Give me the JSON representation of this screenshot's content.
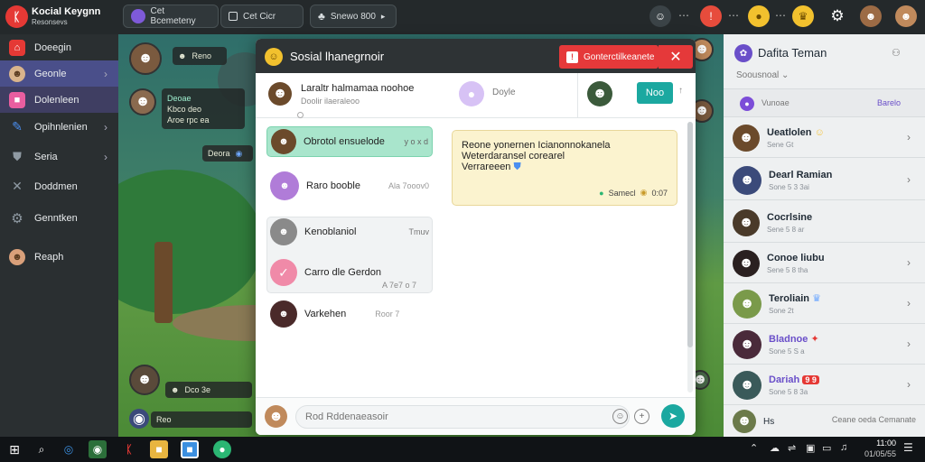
{
  "app": {
    "title": "Kocial Keygnn",
    "subtitle": "Resonsevs",
    "logo": "ᛕ"
  },
  "topbar": {
    "search_label": "Cet Bcemeteny",
    "tab_label": "Cet Cicr",
    "game_label": "Snewo 800",
    "icons": [
      "user-icon",
      "notification-icon",
      "coin-icon",
      "trophy-icon",
      "settings-icon"
    ]
  },
  "sidebar": {
    "items": [
      {
        "label": "Doeegin",
        "icon": "home-icon",
        "color": "#e53935"
      },
      {
        "label": "Geonle",
        "icon": "people-icon",
        "color": "#d9b48c",
        "active": true
      },
      {
        "label": "Dolenleen",
        "icon": "folder-icon",
        "color": "#e95ea0"
      },
      {
        "label": "Opihnlenien",
        "icon": "pen-icon",
        "color": "#4b8ff0"
      },
      {
        "label": "Seria",
        "icon": "shield-icon",
        "color": "#8f9aa3"
      },
      {
        "label": "Doddmen",
        "icon": "tools-icon",
        "color": "#8f9aa3"
      },
      {
        "label": "Genntken",
        "icon": "gear-icon",
        "color": "#8f9aa3"
      },
      {
        "label": "Reaph",
        "icon": "avatar-icon",
        "color": "#d9a07a"
      }
    ]
  },
  "scene": {
    "bubbles": [
      {
        "label": "Reno"
      },
      {
        "label": "Deoae",
        "line2": "Kbco deo",
        "line3": "Aroe rpc ea"
      },
      {
        "label": "Deora"
      },
      {
        "label": "Dco 3e"
      },
      {
        "label": "Reo"
      }
    ]
  },
  "modal": {
    "title": "Sosial lhanegrnoir",
    "warning": "Gonterctilkeanete",
    "close_label": "✕",
    "conversation": {
      "title": "Laraltr halmamaa noohoe",
      "subtitle": "Doolir ilaeraleoo",
      "second_label": "Doyle",
      "button": "Noo"
    },
    "messages": [
      {
        "text": "Obrotol ensuelode",
        "meta": "y o x d",
        "highlight": true
      },
      {
        "text": "Raro booble",
        "meta": "Ala  7ooov0"
      },
      {
        "text": "Kenoblaniol",
        "meta": "Tmuv"
      },
      {
        "text": "Carro dle Gerdon",
        "meta": "A  7e7  o 7"
      },
      {
        "text": "Varkehen",
        "meta": "Roor 7"
      }
    ],
    "reply": {
      "line1": "Reone yonernen Icianonnokanela",
      "line2": "Weterdaransel corearel",
      "line3": "Verrareeen",
      "footer_name": "Samecl",
      "footer_time": "0:07"
    },
    "input_placeholder": "Rod Rddenaeasoir"
  },
  "right_panel": {
    "title": "Dafita Teman",
    "dropdown": "Soousnoal",
    "filter_label": "Vunoae",
    "filter_action": "Barelo",
    "friends": [
      {
        "name": "Ueatlolen",
        "status": "Sene Gt",
        "badge": "☺",
        "badge_color": "#f5c542",
        "online": "#2bb673"
      },
      {
        "name": "Dearl Ramian",
        "status": "Sone 5 3 3ai",
        "badge": "",
        "badge_color": "",
        "online": "#7c4dd8"
      },
      {
        "name": "Cocrlsine",
        "status": "Sene 5 8 ar",
        "badge": "",
        "badge_color": "",
        "online": "#2bb673"
      },
      {
        "name": "Conoe liubu",
        "status": "Sene 5 8 tha",
        "badge": "",
        "badge_color": "",
        "online": "#f5a623"
      },
      {
        "name": "Teroliain",
        "status": "Sone 2t",
        "badge": "♛",
        "badge_color": "#6ea8ff",
        "online": "#f5a623"
      },
      {
        "name": "Bladnoe",
        "status": "Sone 5 S a",
        "badge": "✦",
        "badge_color": "#e53935",
        "online": "#7c4dd8"
      },
      {
        "name": "Dariah",
        "status": "Sone 5 8 3a",
        "badge": "9 9",
        "badge_color": "#e53935",
        "online": "#2bb673"
      },
      {
        "name": "Hs",
        "status": "Ceane oeda Cemanate",
        "badge": "",
        "badge_color": "",
        "online": ""
      }
    ]
  },
  "taskbar": {
    "time": "11:00",
    "date": "01/05/55"
  }
}
